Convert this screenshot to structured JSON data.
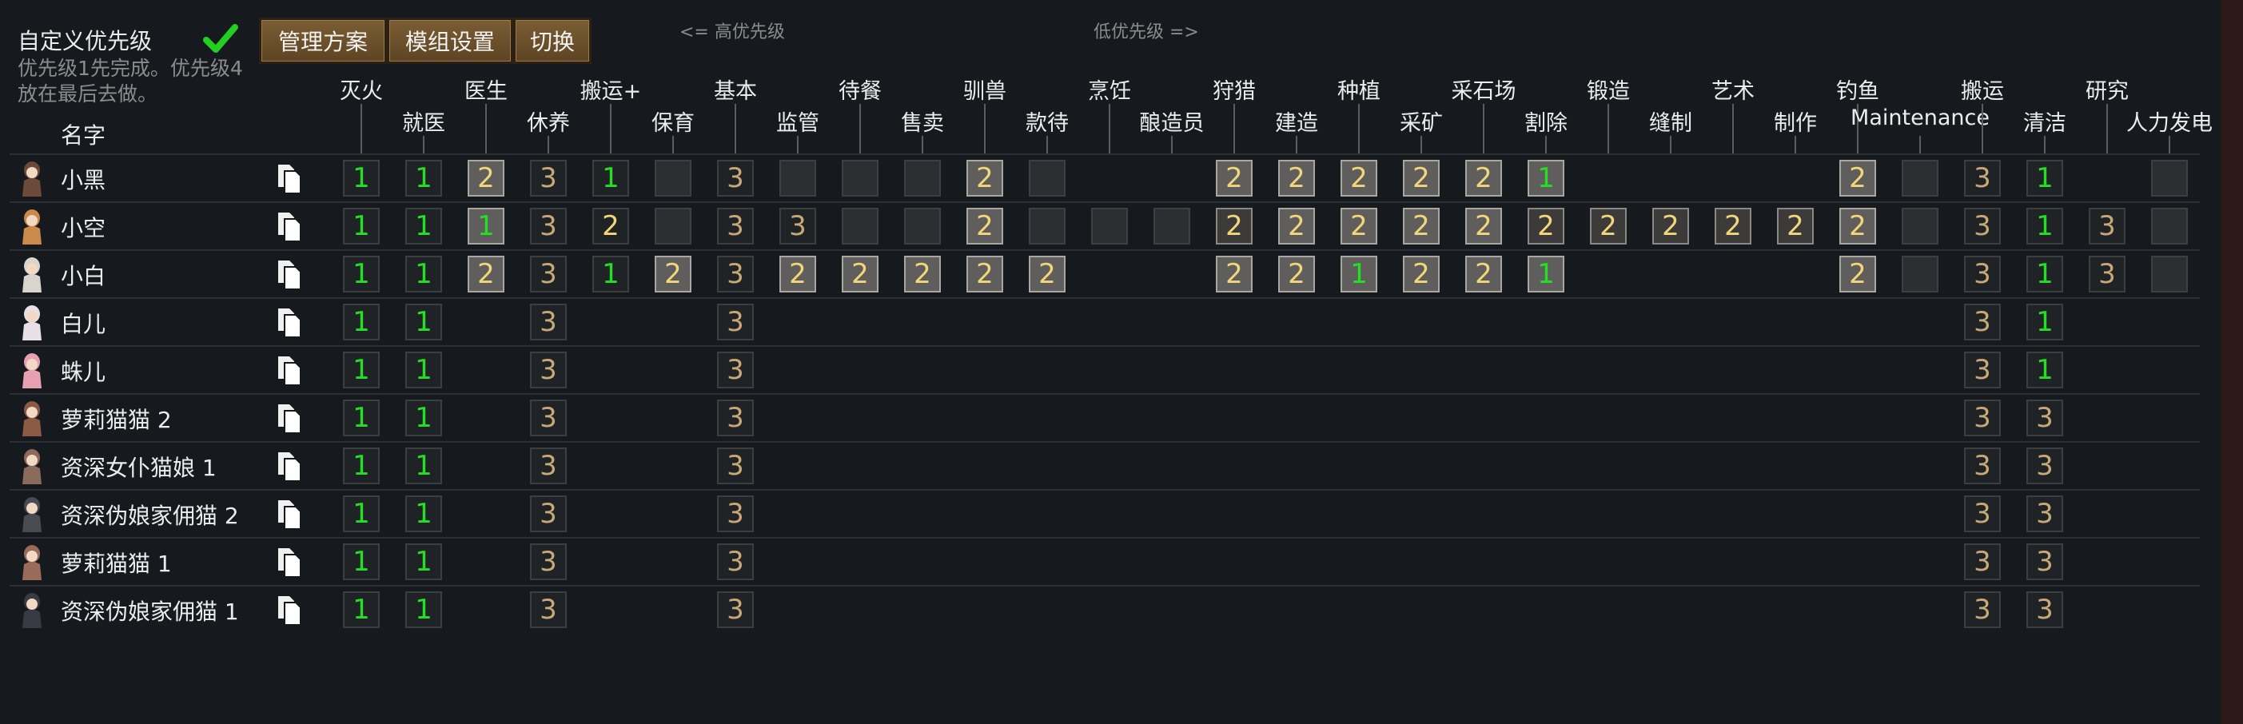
{
  "header": {
    "custom_priority_label": "自定义优先级",
    "hint": "优先级1先完成。优先级4放在最后去做。",
    "buttons": [
      "管理方案",
      "模组设置",
      "切换"
    ],
    "high_priority_hint": "<= 高优先级",
    "low_priority_hint": "低优先级 =>",
    "name_column": "名字"
  },
  "work_types": [
    "灭火",
    "就医",
    "医生",
    "休养",
    "搬运+",
    "保育",
    "基本",
    "监管",
    "待餐",
    "售卖",
    "驯兽",
    "款待",
    "烹饪",
    "酿造员",
    "狩猎",
    "建造",
    "种植",
    "采矿",
    "采石场",
    "割除",
    "锻造",
    "缝制",
    "艺术",
    "制作",
    "钓鱼",
    "Maintenance",
    "搬运",
    "清洁",
    "研究",
    "人力发电"
  ],
  "colors": {
    "accent_green": "#24e024",
    "priority2": "#f1d67a",
    "priority3": "#c9a877",
    "button_brown": "#6b5030"
  },
  "pawns": [
    {
      "name": "小黑",
      "avatar": "pawn-portrait-icon",
      "cells": [
        "1",
        "1",
        "2P",
        "3",
        "1",
        "E",
        "3",
        "E",
        "E",
        "E",
        "2P",
        "E",
        "",
        "",
        "2P",
        "2P",
        "2P",
        "2P",
        "2P",
        "1P",
        "",
        "",
        "",
        "",
        "2P",
        "E",
        "3",
        "1",
        "",
        "E"
      ]
    },
    {
      "name": "小空",
      "avatar": "pawn-portrait-icon",
      "cells": [
        "1",
        "1",
        "1P",
        "3",
        "2",
        "E",
        "3",
        "3",
        "E",
        "E",
        "2P",
        "E",
        "E",
        "E",
        "2M",
        "2P",
        "2P",
        "2P",
        "2P",
        "2M",
        "2M",
        "2M",
        "2M",
        "2M",
        "2P",
        "E",
        "3",
        "1",
        "3",
        "E"
      ]
    },
    {
      "name": "小白",
      "avatar": "pawn-portrait-icon",
      "cells": [
        "1",
        "1",
        "2P",
        "3",
        "1",
        "2P",
        "3",
        "2P",
        "2P",
        "2P",
        "2P",
        "2P",
        "",
        "",
        "2P",
        "2P",
        "1P",
        "2P",
        "2P",
        "1P",
        "",
        "",
        "",
        "",
        "2P",
        "E",
        "3",
        "1",
        "3",
        "E"
      ]
    },
    {
      "name": "白儿",
      "avatar": "pawn-portrait-icon",
      "cells": [
        "1",
        "1",
        "",
        "3",
        "",
        "",
        "3",
        "",
        "",
        "",
        "",
        "",
        "",
        "",
        "",
        "",
        "",
        "",
        "",
        "",
        "",
        "",
        "",
        "",
        "",
        "",
        "3",
        "1",
        "",
        ""
      ]
    },
    {
      "name": "蛛儿",
      "avatar": "pawn-portrait-icon",
      "cells": [
        "1",
        "1",
        "",
        "3",
        "",
        "",
        "3",
        "",
        "",
        "",
        "",
        "",
        "",
        "",
        "",
        "",
        "",
        "",
        "",
        "",
        "",
        "",
        "",
        "",
        "",
        "",
        "3",
        "1",
        "",
        ""
      ]
    },
    {
      "name": "萝莉猫猫 2",
      "avatar": "pawn-portrait-icon",
      "cells": [
        "1",
        "1",
        "",
        "3",
        "",
        "",
        "3",
        "",
        "",
        "",
        "",
        "",
        "",
        "",
        "",
        "",
        "",
        "",
        "",
        "",
        "",
        "",
        "",
        "",
        "",
        "",
        "3",
        "3",
        "",
        ""
      ]
    },
    {
      "name": "资深女仆猫娘 1",
      "avatar": "pawn-portrait-icon",
      "cells": [
        "1",
        "1",
        "",
        "3",
        "",
        "",
        "3",
        "",
        "",
        "",
        "",
        "",
        "",
        "",
        "",
        "",
        "",
        "",
        "",
        "",
        "",
        "",
        "",
        "",
        "",
        "",
        "3",
        "3",
        "",
        ""
      ]
    },
    {
      "name": "资深伪娘家佣猫 2",
      "avatar": "pawn-portrait-icon",
      "cells": [
        "1",
        "1",
        "",
        "3",
        "",
        "",
        "3",
        "",
        "",
        "",
        "",
        "",
        "",
        "",
        "",
        "",
        "",
        "",
        "",
        "",
        "",
        "",
        "",
        "",
        "",
        "",
        "3",
        "3",
        "",
        ""
      ]
    },
    {
      "name": "萝莉猫猫 1",
      "avatar": "pawn-portrait-icon",
      "cells": [
        "1",
        "1",
        "",
        "3",
        "",
        "",
        "3",
        "",
        "",
        "",
        "",
        "",
        "",
        "",
        "",
        "",
        "",
        "",
        "",
        "",
        "",
        "",
        "",
        "",
        "",
        "",
        "3",
        "3",
        "",
        ""
      ]
    },
    {
      "name": "资深伪娘家佣猫 1",
      "avatar": "pawn-portrait-icon",
      "cells": [
        "1",
        "1",
        "",
        "3",
        "",
        "",
        "3",
        "",
        "",
        "",
        "",
        "",
        "",
        "",
        "",
        "",
        "",
        "",
        "",
        "",
        "",
        "",
        "",
        "",
        "",
        "",
        "3",
        "3",
        "",
        ""
      ]
    }
  ]
}
